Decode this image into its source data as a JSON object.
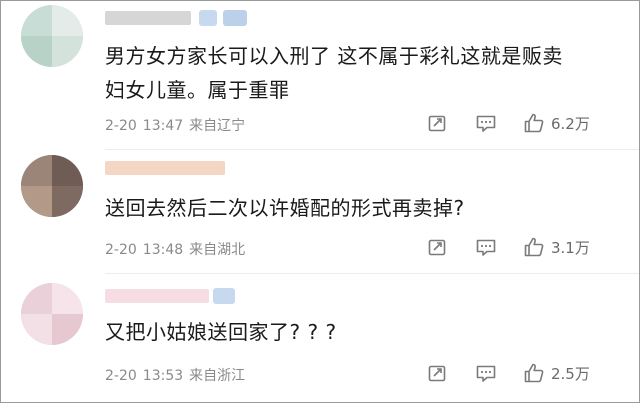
{
  "comments": [
    {
      "text_line1": "男方女方家长可以入刑了 这不属于彩礼这就是贩卖",
      "text_line2": "妇女儿童。属于重罪",
      "date": "2-20",
      "time": "13:47",
      "location": "来自辽宁",
      "likes": "6.2万"
    },
    {
      "text_line1": "送回去然后二次以许婚配的形式再卖掉?",
      "text_line2": "",
      "date": "2-20",
      "time": "13:48",
      "location": "来自湖北",
      "likes": "3.1万"
    },
    {
      "text_line1": "又把小姑娘送回家了? ? ?",
      "text_line2": "",
      "date": "2-20",
      "time": "13:53",
      "location": "来自浙江",
      "likes": "2.5万"
    }
  ],
  "icons": {
    "share": "share-icon",
    "reply": "comment-icon",
    "like": "thumbs-up-icon"
  },
  "colors": {
    "text": "#1a1a1a",
    "meta": "#8a8a8a",
    "icon": "#7a7a7a"
  }
}
